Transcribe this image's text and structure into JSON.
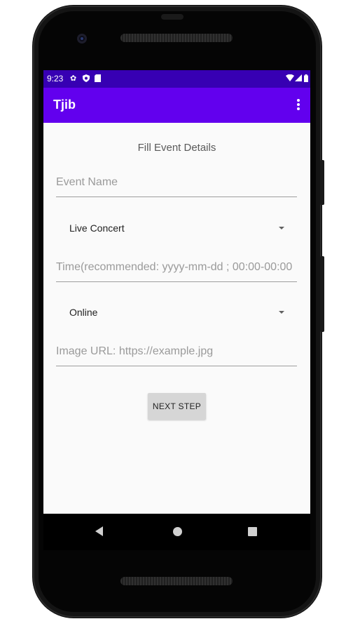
{
  "statusbar": {
    "time": "9:23",
    "icons": [
      "settings-icon",
      "shield-icon",
      "sd-card-icon",
      "wifi-icon",
      "signal-icon",
      "battery-icon"
    ]
  },
  "appbar": {
    "title": "Tjib",
    "menu_icon": "overflow-menu-icon"
  },
  "form": {
    "title": "Fill Event Details",
    "event_name": {
      "value": "",
      "placeholder": "Event Name"
    },
    "category": {
      "selected": "Live Concert"
    },
    "time": {
      "value": "",
      "placeholder": "Time(recommended: yyyy-mm-dd ; 00:00-00:00"
    },
    "location_type": {
      "selected": "Online"
    },
    "image_url": {
      "value": "",
      "placeholder": "Image URL: https://example.jpg"
    },
    "next_label": "NEXT STEP"
  },
  "navbar": {
    "icons": [
      "back-icon",
      "home-icon",
      "recents-icon"
    ]
  },
  "colors": {
    "status_bar": "#3700b3",
    "app_bar": "#6200ee",
    "background": "#fafafa",
    "button": "#d6d6d6"
  }
}
